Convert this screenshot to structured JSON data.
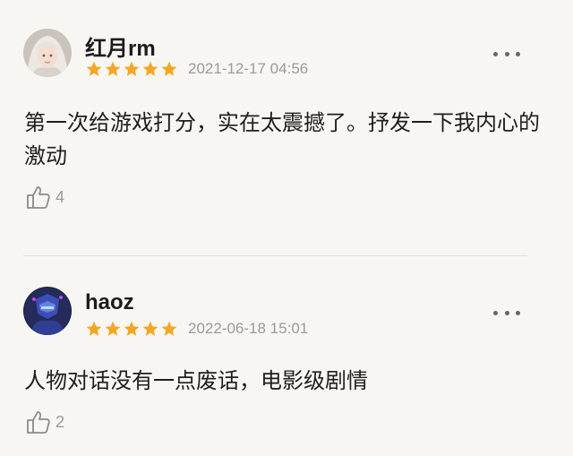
{
  "reviews": [
    {
      "username": "红月rm",
      "rating": 5,
      "date": "2021-12-17 04:56",
      "content": "第一次给游戏打分，实在太震撼了。抒发一下我内心的激动",
      "likes": "4",
      "avatar_icon": "avatar-silver-haired-girl"
    },
    {
      "username": "haoz",
      "rating": 5,
      "date": "2022-06-18 15:01",
      "content": "人物对话没有一点废话，电影级剧情",
      "likes": "2",
      "avatar_icon": "avatar-blue-mech"
    }
  ],
  "colors": {
    "star": "#f5a623",
    "background": "#f8f6f2",
    "meta_text": "#9a9a9a"
  }
}
